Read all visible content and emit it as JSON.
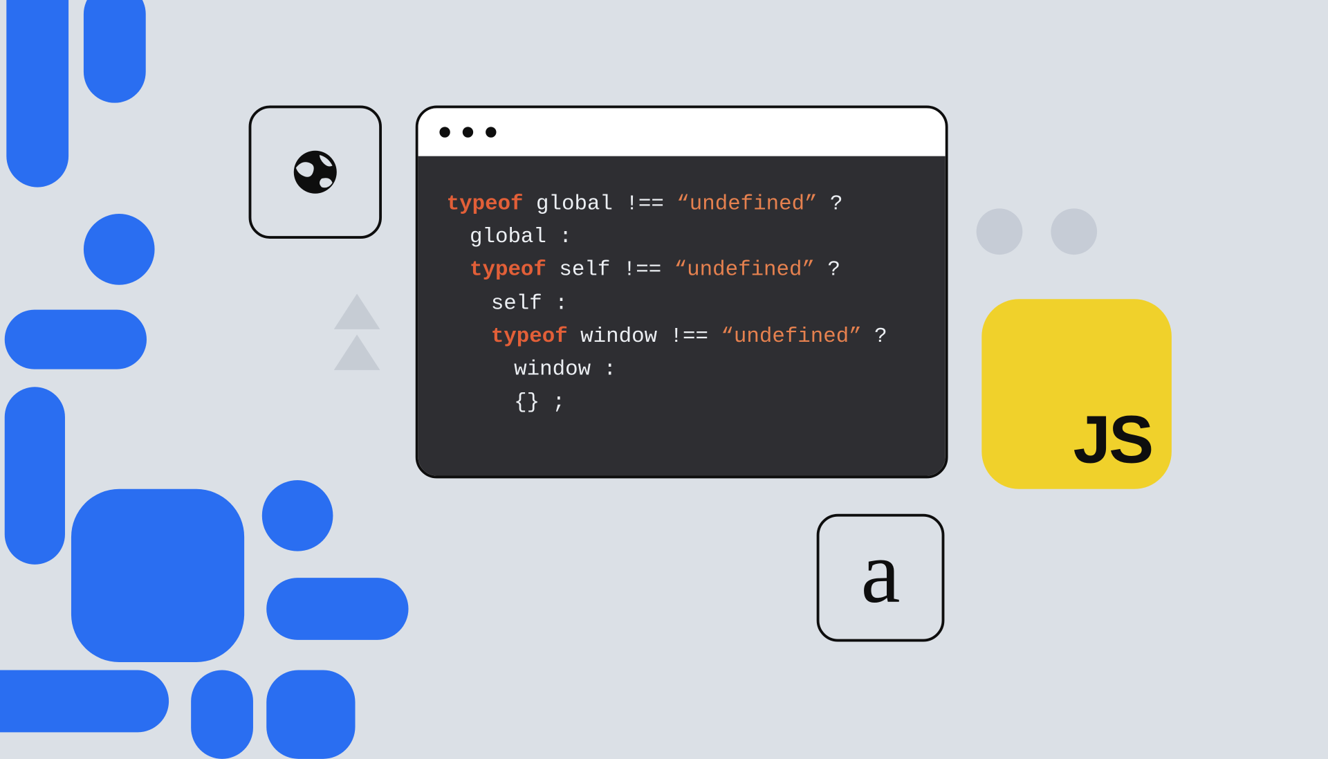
{
  "colors": {
    "background": "#dbe0e6",
    "blue": "#2a6ef1",
    "code_bg": "#2e2e32",
    "code_text": "#eceff3",
    "keyword": "#e25f38",
    "string": "#e6814f",
    "js_yellow": "#f0d12b",
    "gray_shape": "#c6ccd4",
    "stroke": "#0e0e0e"
  },
  "icons": {
    "globe": "globe-icon",
    "a": "a"
  },
  "js_badge": {
    "label": "JS"
  },
  "window": {
    "traffic_light_count": 3
  },
  "code": {
    "kw_typeof_1": "typeof",
    "g_global": " global !== ",
    "str_undef_1": "“undefined”",
    "q1": " ?",
    "l2": "global :",
    "kw_typeof_2": "typeof",
    "g_self": " self !== ",
    "str_undef_2": "“undefined”",
    "q2": " ?",
    "l4": "self :",
    "kw_typeof_3": "typeof",
    "g_window": " window !== ",
    "str_undef_3": "“undefined”",
    "q3": " ?",
    "l6": "window :",
    "l7": "{} ;"
  }
}
